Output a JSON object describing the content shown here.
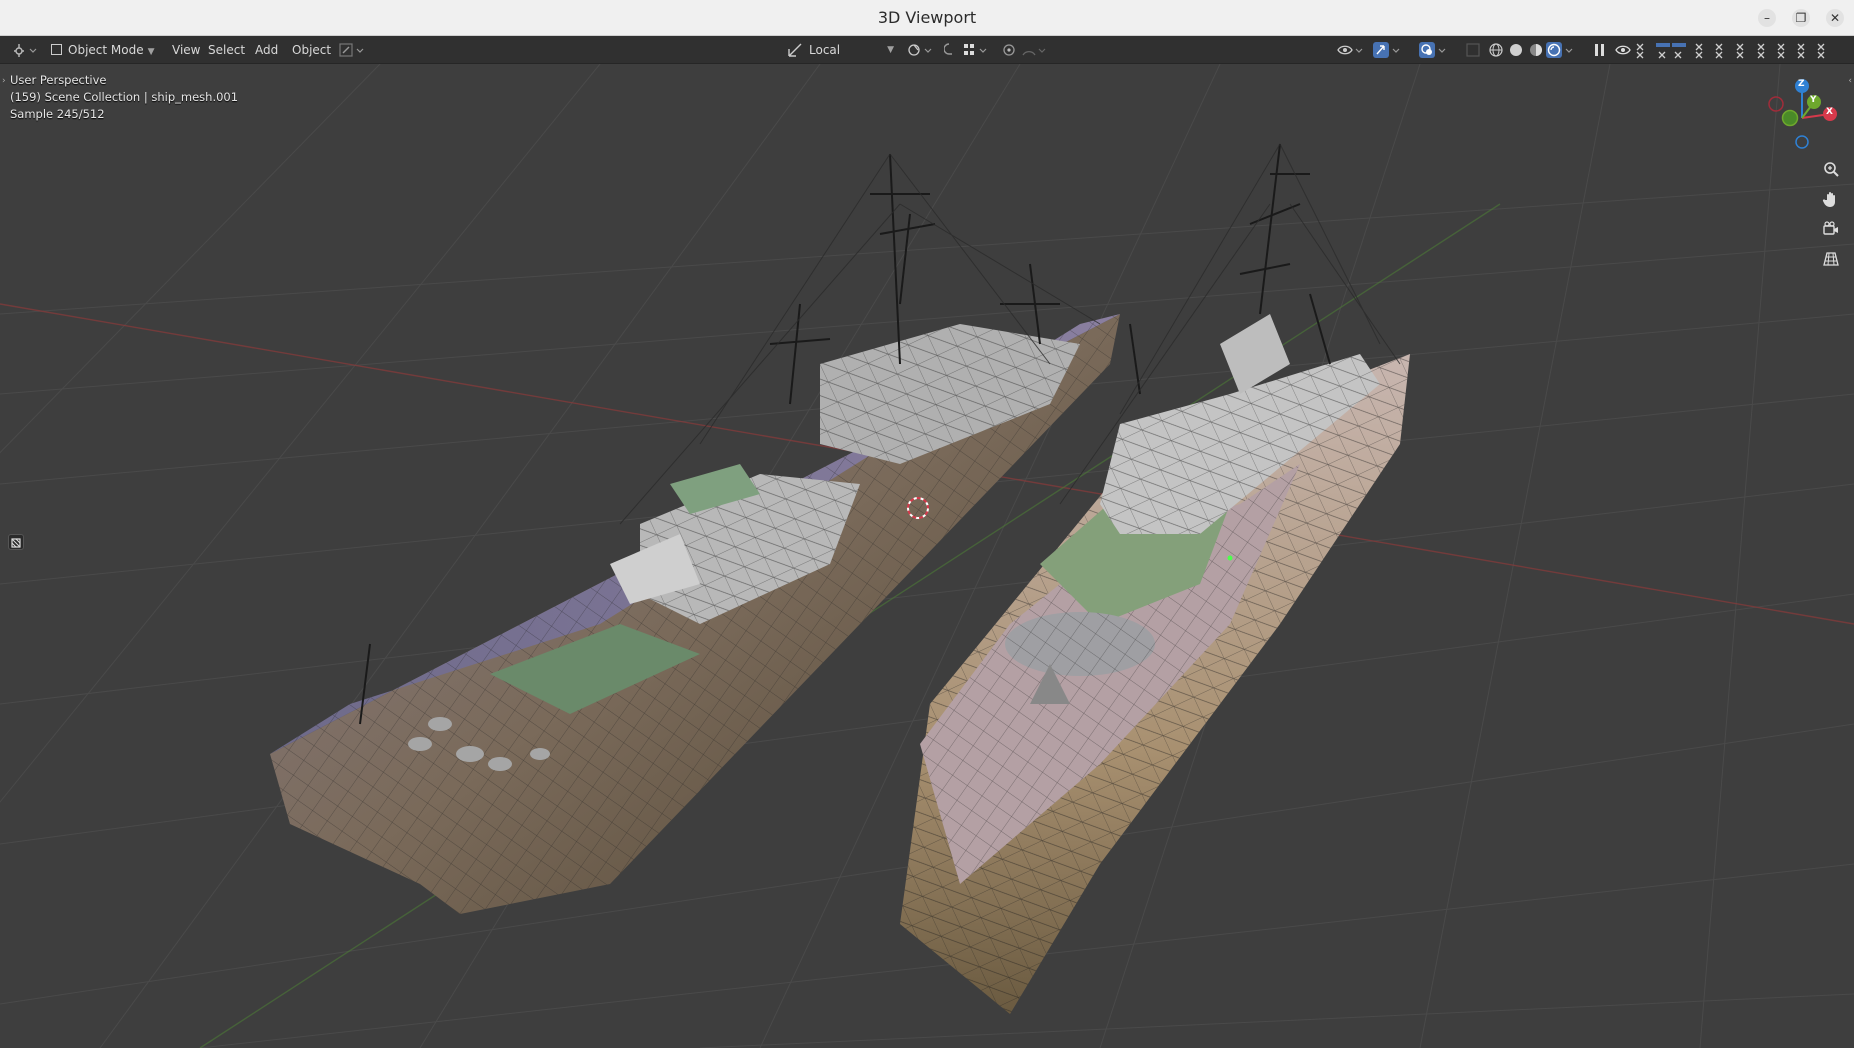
{
  "window": {
    "title": "3D Viewport",
    "controls": {
      "minimize": "–",
      "restore": "❐",
      "close": "✕"
    }
  },
  "header": {
    "editor_type_icon": "editor-type-icon",
    "mode": "Object Mode",
    "menus": [
      "View",
      "Select",
      "Add",
      "Object"
    ],
    "transform_orientation": "Local"
  },
  "viewport": {
    "info": {
      "perspective": "User Perspective",
      "collection": "(159) Scene Collection | ship_mesh.001",
      "sample": "Sample 245/512"
    },
    "axis_labels": {
      "x": "X",
      "y": "Y",
      "z": "Z"
    }
  },
  "colors": {
    "accent_blue": "#4772b3",
    "axis_red": "#d6394b",
    "axis_green": "#6ea82d",
    "axis_blue": "#2f81d4"
  }
}
